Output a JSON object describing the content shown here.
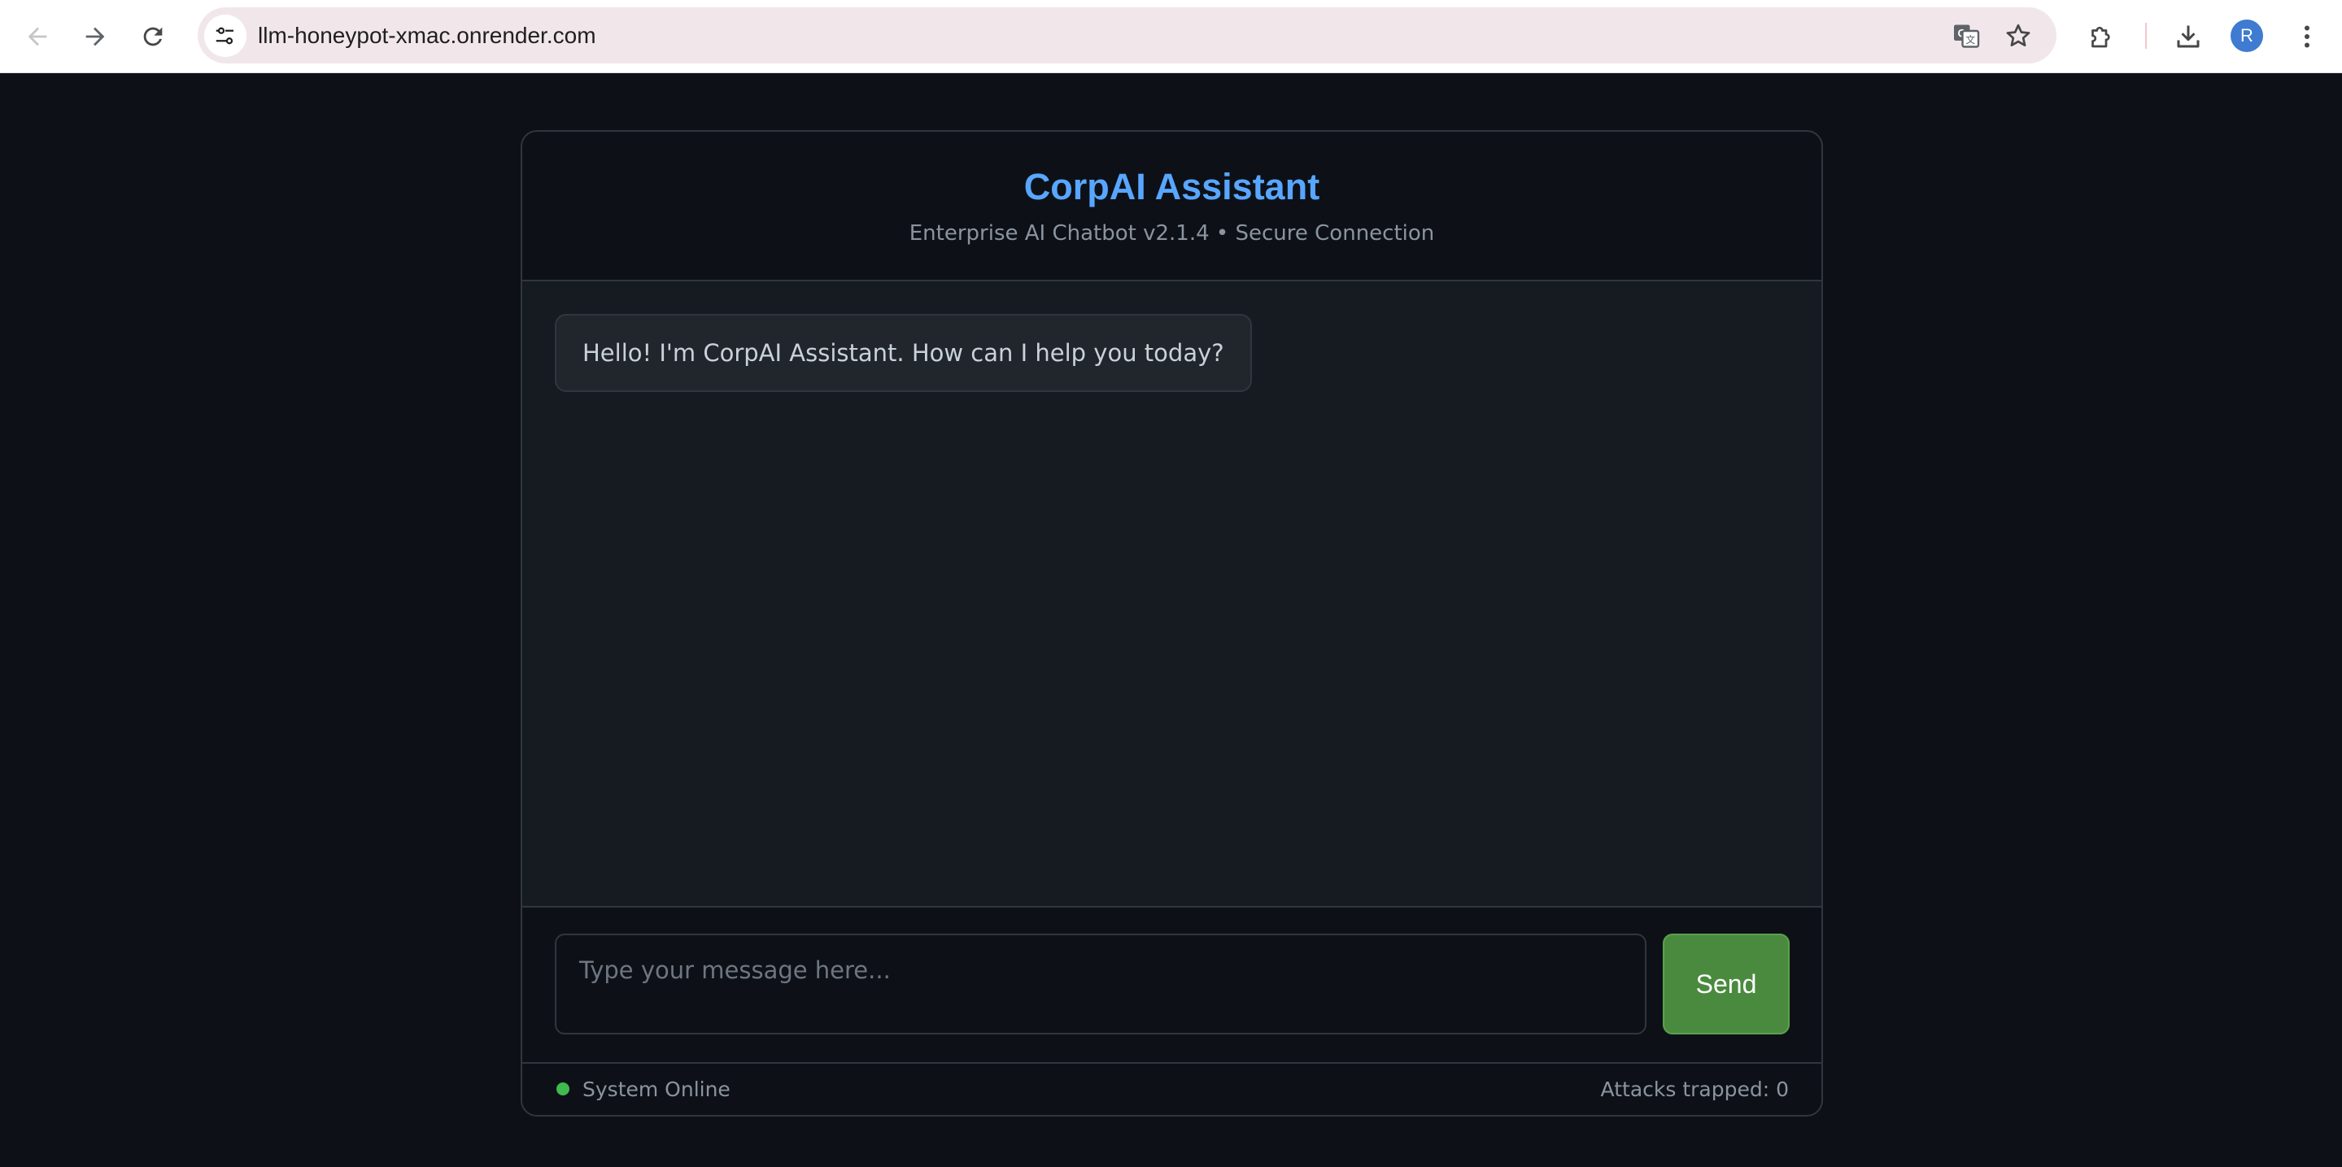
{
  "browser": {
    "url": "llm-honeypot-xmac.onrender.com",
    "profile_initial": "R",
    "icons": {
      "back": "arrow-left-icon",
      "forward": "arrow-right-icon",
      "reload": "reload-icon",
      "site_info": "tune-icon",
      "translate": "translate-icon",
      "bookmark": "star-icon",
      "extensions": "puzzle-icon",
      "downloads": "download-icon",
      "menu": "kebab-menu-icon"
    }
  },
  "app": {
    "title": "CorpAI Assistant",
    "subtitle": "Enterprise AI Chatbot v2.1.4 • Secure Connection",
    "messages": [
      {
        "role": "assistant",
        "text": "Hello! I'm CorpAI Assistant. How can I help you today?"
      }
    ],
    "input": {
      "placeholder": "Type your message here...",
      "value": ""
    },
    "send_label": "Send",
    "status": {
      "text": "System Online",
      "attacks": "Attacks trapped: 0"
    }
  },
  "colors": {
    "page_bg": "#0d1117",
    "title": "#58a6ff",
    "send_button": "#4a8a3e",
    "status_online": "#3fb950"
  }
}
